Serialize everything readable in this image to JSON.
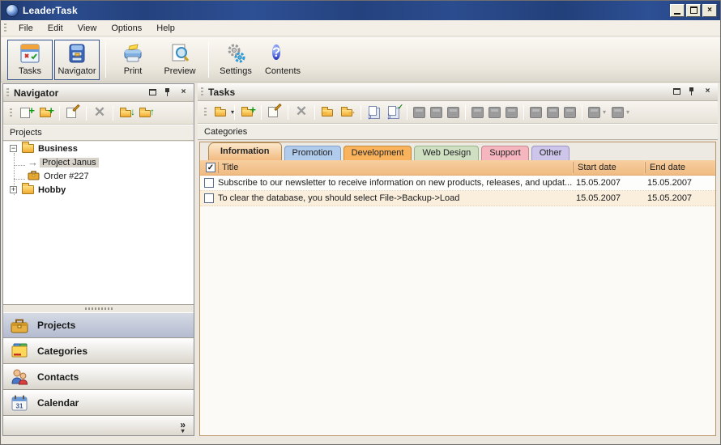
{
  "window": {
    "title": "LeaderTask",
    "controls": {
      "minimize": "minimize",
      "maximize": "maximize",
      "close": "close"
    }
  },
  "menu_bar": {
    "items": [
      {
        "label": "File"
      },
      {
        "label": "Edit"
      },
      {
        "label": "View"
      },
      {
        "label": "Options"
      },
      {
        "label": "Help"
      }
    ]
  },
  "main_toolbar": {
    "buttons": [
      {
        "label": "Tasks",
        "icon": "tasks-icon",
        "selected": true
      },
      {
        "label": "Navigator",
        "icon": "navigator-icon",
        "selected": true
      },
      {
        "label": "Print",
        "icon": "print-icon",
        "selected": false
      },
      {
        "label": "Preview",
        "icon": "preview-icon",
        "selected": false
      },
      {
        "label": "Settings",
        "icon": "settings-icon",
        "selected": false
      },
      {
        "label": "Contents",
        "icon": "contents-icon",
        "selected": false
      }
    ],
    "contents_glyph": "?"
  },
  "navigator_panel": {
    "title": "Navigator",
    "toolbar_icons": [
      "add-task-icon",
      "add-folder-icon",
      "edit-icon",
      "delete-icon",
      "folder-down-icon",
      "folder-up-icon"
    ],
    "section_label": "Projects",
    "tree": [
      {
        "label": "Business",
        "icon": "folder-icon",
        "expander": "-",
        "bold": true,
        "selected": false
      },
      {
        "label": "Project Janus",
        "icon": "arrow-icon",
        "bold": false,
        "selected": true
      },
      {
        "label": "Order #227",
        "icon": "briefcase-icon",
        "bold": false,
        "selected": false
      },
      {
        "label": "Hobby",
        "icon": "folder-icon",
        "expander": "+",
        "bold": true,
        "selected": false
      }
    ],
    "stack_buttons": [
      {
        "label": "Projects",
        "icon": "briefcase-icon",
        "selected": true
      },
      {
        "label": "Categories",
        "icon": "categories-icon",
        "selected": false
      },
      {
        "label": "Contacts",
        "icon": "contacts-icon",
        "selected": false
      },
      {
        "label": "Calendar",
        "icon": "calendar-icon",
        "selected": false
      }
    ],
    "footer_chevron": "»",
    "footer_arrow": "▾"
  },
  "tasks_panel": {
    "title": "Tasks",
    "toolbar_icons": [
      "open-folder-menu-icon",
      "new-task-icon",
      "edit-task-icon",
      "delete-task-icon",
      "move-prev-icon",
      "move-next-icon",
      "fill-down-icon",
      "fill-down-check-icon"
    ],
    "disabled_toolbar_icon_count": 11,
    "section_label": "Categories",
    "tabs": [
      {
        "label": "Information",
        "color": "#f2ba80",
        "active": true
      },
      {
        "label": "Promotion",
        "color": "#b0cbec",
        "active": false
      },
      {
        "label": "Development",
        "color": "#f8b35c",
        "active": false
      },
      {
        "label": "Web Design",
        "color": "#cfe0c2",
        "active": false
      },
      {
        "label": "Support",
        "color": "#f6b6bf",
        "active": false
      },
      {
        "label": "Other",
        "color": "#cdc5ea",
        "active": false
      }
    ],
    "table": {
      "header": {
        "title": "Title",
        "start_date": "Start date",
        "end_date": "End date",
        "checkbox_checked": true,
        "check_glyph": "✓"
      },
      "rows": [
        {
          "checked": false,
          "title": "Subscribe to our newsletter to receive information on new products, releases, and updat...",
          "start_date": "15.05.2007",
          "end_date": "15.05.2007",
          "background": "#fdfdfb"
        },
        {
          "checked": false,
          "title": "To clear the database, you should select File->Backup->Load",
          "start_date": "15.05.2007",
          "end_date": "15.05.2007",
          "background": "#faeedd"
        }
      ]
    }
  },
  "colors": {
    "titlebar": "#24427e",
    "chrome": "#ece7df",
    "grid_header": "#f3c28d",
    "row_alt": "#faeedd",
    "selected_stack": "#bcc3d6",
    "content_border": "#b89468"
  }
}
